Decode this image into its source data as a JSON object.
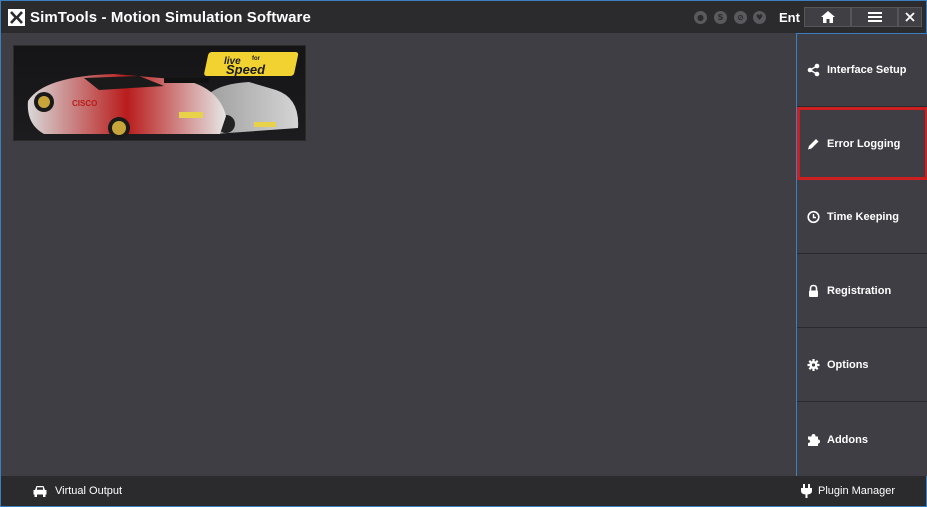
{
  "window": {
    "title": "SimTools - Motion Simulation Software",
    "user_label": "Ent",
    "accent_color": "#3a7fbf",
    "selection_color": "#cc1f1f"
  },
  "titlebar": {
    "social_icons": [
      "github-icon",
      "skype-icon",
      "link-icon",
      "tag-icon"
    ],
    "buttons": [
      "home-icon",
      "menu-icon",
      "close-icon"
    ]
  },
  "banner": {
    "game_logo_text": "Live for Speed",
    "logo_line1": "live",
    "logo_line2": "Speed",
    "logo_small": "for"
  },
  "sidebar": {
    "items": [
      {
        "label": "Interface Setup",
        "icon": "share-icon"
      },
      {
        "label": "Error Logging",
        "icon": "pencil-icon",
        "selected": true
      },
      {
        "label": "Time Keeping",
        "icon": "clock-icon"
      },
      {
        "label": "Registration",
        "icon": "lock-icon"
      },
      {
        "label": "Options",
        "icon": "gear-icon"
      },
      {
        "label": "Addons",
        "icon": "puzzle-icon"
      }
    ]
  },
  "bottombar": {
    "virtual_output": "Virtual Output",
    "plugin_manager": "Plugin Manager"
  }
}
